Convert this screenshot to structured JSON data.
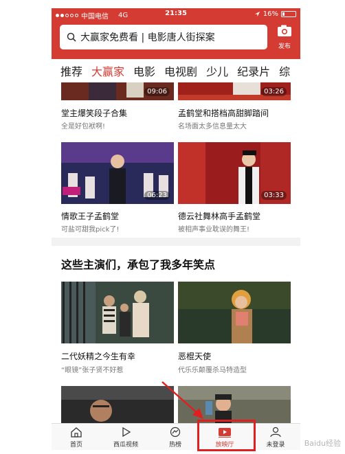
{
  "status_bar": {
    "carrier": "中国电信",
    "network": "4G",
    "time": "21:35",
    "battery": "16%",
    "battery_level": 0.16
  },
  "search": {
    "placeholder": "大赢家免费看 | 电影唐人街探案"
  },
  "publish": {
    "label": "发布",
    "icon": "camera-icon"
  },
  "tabs": [
    {
      "label": "推荐",
      "active": false
    },
    {
      "label": "大赢家",
      "active": true
    },
    {
      "label": "电影",
      "active": false
    },
    {
      "label": "电视剧",
      "active": false
    },
    {
      "label": "少儿",
      "active": false
    },
    {
      "label": "纪录片",
      "active": false
    },
    {
      "label": "综",
      "active": false
    }
  ],
  "feed_top": [
    {
      "title": "堂主爆笑段子合集",
      "subtitle": "全是好包袱啊!",
      "duration": "09:06"
    },
    {
      "title": "孟鹤堂和搭档高甜脚踏间",
      "subtitle": "名场面太多信息量太大",
      "duration": "03:26"
    },
    {
      "title": "情歌王子孟鹤堂",
      "subtitle": "可盐可甜我pick了!",
      "duration": "06:23"
    },
    {
      "title": "德云社舞林高手孟鹤堂",
      "subtitle": "被相声事业耽误的舞王!",
      "duration": "03:33"
    }
  ],
  "section": {
    "title": "这些主演们，承包了我多年笑点",
    "items": [
      {
        "title": "二代妖精之今生有幸",
        "subtitle": "“眼镜”张子贤不好惹"
      },
      {
        "title": "恶棍天使",
        "subtitle": "代乐乐颠覆杀马特造型"
      }
    ]
  },
  "bottom_nav": [
    {
      "label": "首页",
      "icon": "home-icon",
      "active": false
    },
    {
      "label": "西瓜视频",
      "icon": "play-icon",
      "active": false
    },
    {
      "label": "热榜",
      "icon": "hot-list-icon",
      "active": false
    },
    {
      "label": "放映厅",
      "icon": "cinema-icon",
      "active": true
    },
    {
      "label": "未登录",
      "icon": "user-icon",
      "active": false
    }
  ],
  "watermark": "Baidu经验",
  "colors": {
    "brand": "#d43c33",
    "highlight": "#e02020"
  }
}
